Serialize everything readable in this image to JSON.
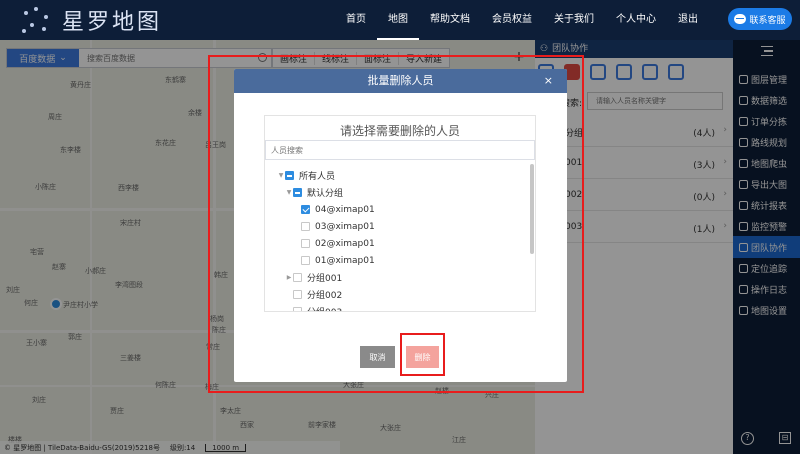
{
  "app": {
    "brand": "星罗地图"
  },
  "nav": {
    "items": [
      "首页",
      "地图",
      "帮助文档",
      "会员权益",
      "关于我们",
      "个人中心",
      "退出"
    ],
    "active_index": 1,
    "contact_label": "联系客服"
  },
  "map": {
    "source_label": "百度数据",
    "search_placeholder": "搜索百度数据",
    "tools": [
      "画标注",
      "线标注",
      "面标注",
      "导入新建"
    ],
    "add_symbol": "+",
    "place_labels": [
      "黄丹庄",
      "东鹤寨",
      "周庄",
      "东李楼",
      "余楼",
      "东花庄",
      "吕王岗",
      "小陈庄",
      "西李楼",
      "宋庄村",
      "宅营",
      "赵寨",
      "小郝庄",
      "韩庄",
      "何庄",
      "刘庄",
      "尹庄村小学",
      "王小寨",
      "李湾图段",
      "郭庄",
      "三姜楼",
      "杨岗",
      "何陈庄",
      "常庄",
      "刘庄",
      "贾庄",
      "李太庄",
      "西家",
      "大张庄",
      "赵楼",
      "兴庄",
      "前李家楼",
      "江庄",
      "楼楼",
      "梅庄",
      "陈庄",
      "大张庄"
    ],
    "footer_copyright": "© 星罗地图 | TileData-Baidu-GS(2019)5218号",
    "zoom_label": "级别:14",
    "scale_label": "1000 m"
  },
  "team_panel": {
    "title": "团队协作",
    "search_label": "搜索:",
    "search_placeholder": "请输入人员名称关键字",
    "groups": [
      {
        "name": "分组",
        "count": "(4人)"
      },
      {
        "name": "001",
        "count": "(3人)"
      },
      {
        "name": "002",
        "count": "(0人)"
      },
      {
        "name": "003",
        "count": "(1人)"
      }
    ]
  },
  "sidebar": {
    "items": [
      "图层管理",
      "数据筛选",
      "订单分拣",
      "路线规划",
      "地图爬虫",
      "导出大图",
      "统计报表",
      "监控预警",
      "团队协作",
      "定位追踪",
      "操作日志",
      "地图设置"
    ],
    "active_index": 8,
    "help_symbol": "?",
    "collapse_symbol": "⊟"
  },
  "modal": {
    "title": "批量删除人员",
    "close_symbol": "×",
    "picker_title": "请选择需要删除的人员",
    "search_placeholder": "人员搜索",
    "tree": [
      {
        "label": "所有人员",
        "level": 0,
        "state": "indeterminate",
        "caret": "▼"
      },
      {
        "label": "默认分组",
        "level": 1,
        "state": "indeterminate",
        "caret": "▼"
      },
      {
        "label": "04@ximap01",
        "level": 2,
        "state": "checked",
        "caret": ""
      },
      {
        "label": "03@ximap01",
        "level": 2,
        "state": "unchecked",
        "caret": ""
      },
      {
        "label": "02@ximap01",
        "level": 2,
        "state": "unchecked",
        "caret": ""
      },
      {
        "label": "01@ximap01",
        "level": 2,
        "state": "unchecked",
        "caret": ""
      },
      {
        "label": "分组001",
        "level": 1,
        "state": "unchecked",
        "caret": "▶"
      },
      {
        "label": "分组002",
        "level": 1,
        "state": "unchecked",
        "caret": ""
      },
      {
        "label": "分组003",
        "level": 1,
        "state": "unchecked",
        "caret": ""
      }
    ],
    "cancel_label": "取消",
    "delete_label": "删除"
  },
  "colors": {
    "topbar": "#0d1e38",
    "accent": "#2d8ce0",
    "modal_header": "#4a6b9c",
    "delete_button": "#f4a39d",
    "highlight": "#e81c1c"
  }
}
